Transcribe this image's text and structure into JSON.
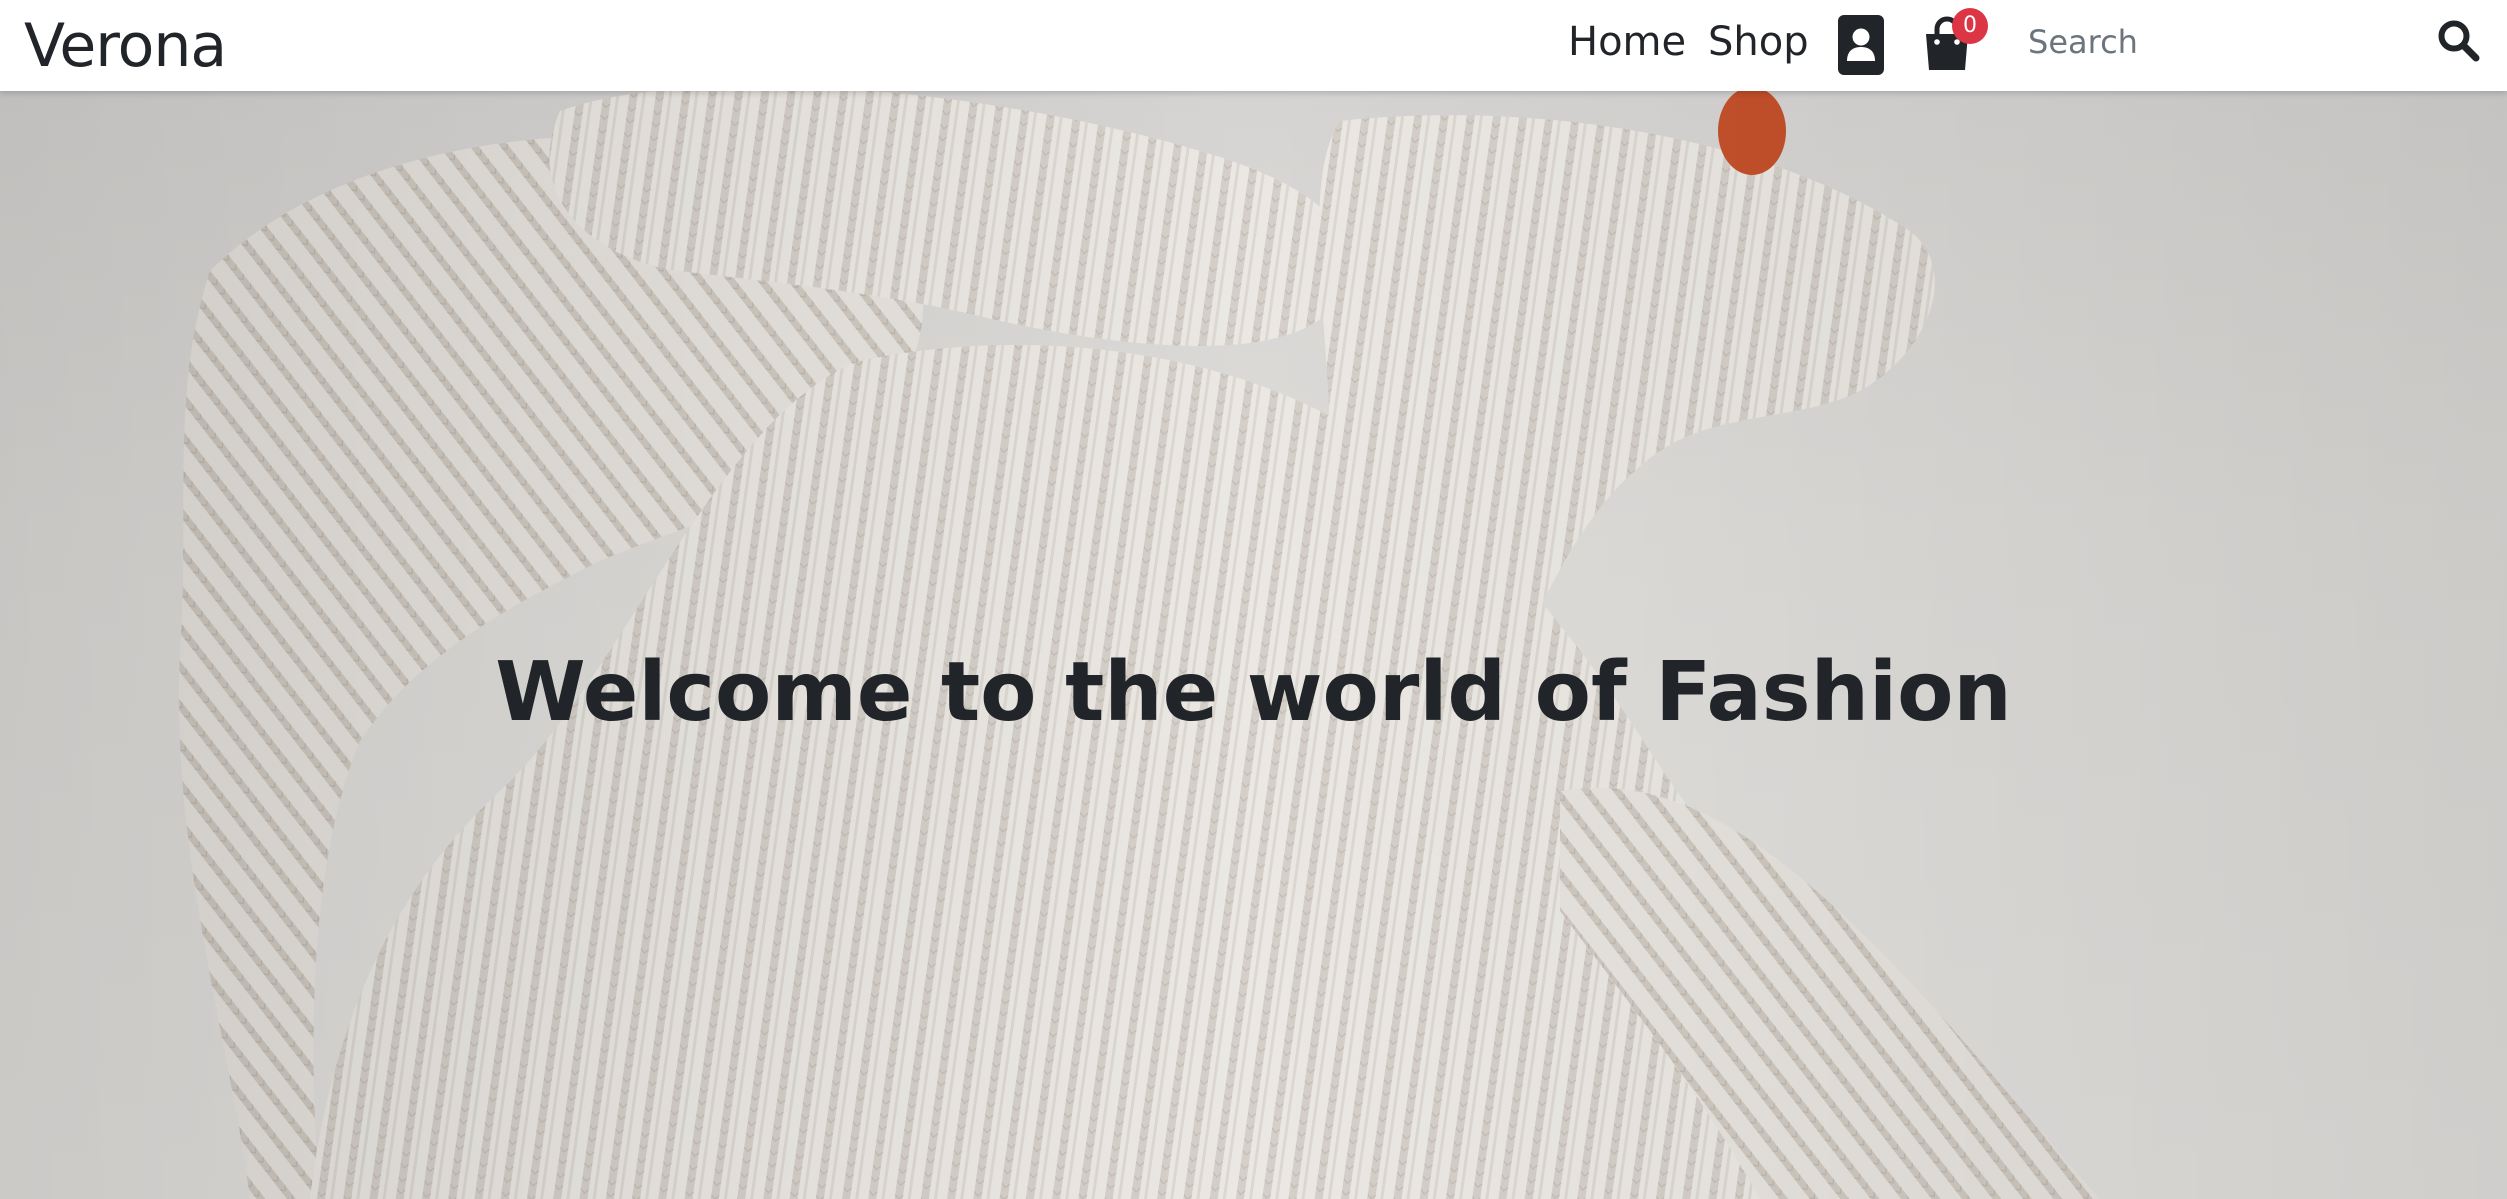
{
  "navbar": {
    "brand": "Verona",
    "links": [
      {
        "label": "Home"
      },
      {
        "label": "Shop"
      }
    ],
    "account_icon": "user-icon",
    "cart": {
      "icon": "shopping-bag-icon",
      "count": "0"
    },
    "search": {
      "placeholder": "Search",
      "value": "",
      "icon": "search-icon"
    }
  },
  "hero": {
    "title": "Welcome to the world of Fashion",
    "image": "knit-sweater-photo"
  },
  "colors": {
    "navbar_bg": "#ffffff",
    "text": "#212529",
    "badge": "#dc3545",
    "hero_bg": "#dcdad7"
  }
}
